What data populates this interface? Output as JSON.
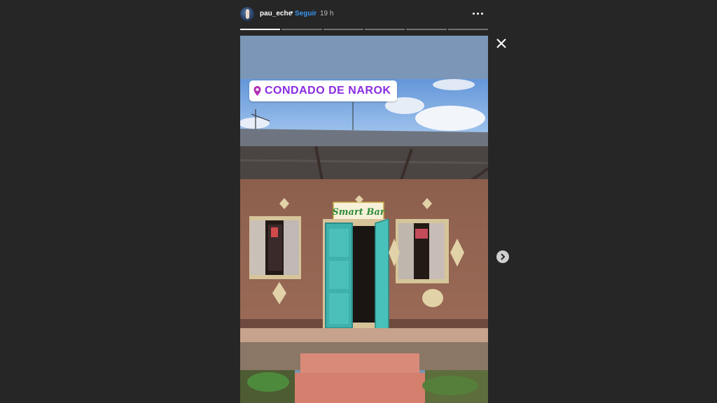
{
  "header": {
    "username": "pau_eche",
    "separator": "•",
    "follow_label": "Seguir",
    "timestamp": "19 h"
  },
  "progress": {
    "segments": 6,
    "active_index": 0
  },
  "sticker": {
    "location": "CONDADO DE NAROK",
    "icon": "location-pin-icon"
  },
  "photo": {
    "sign_text": "Smart Bar"
  },
  "controls": {
    "close_icon": "close-icon",
    "next_icon": "chevron-right-icon",
    "more_icon": "more-options-icon"
  },
  "colors": {
    "background": "#262626",
    "follow": "#3897f0",
    "sticker_text": "#8a2be2"
  }
}
